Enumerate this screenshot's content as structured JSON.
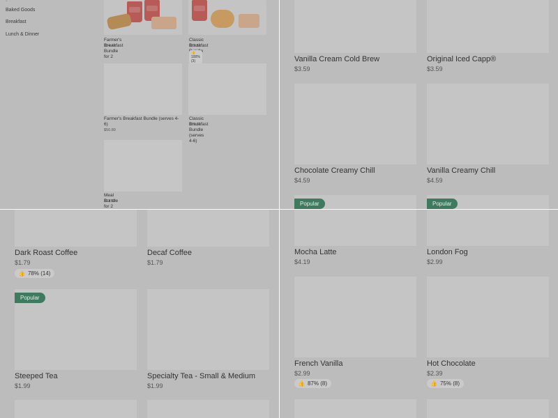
{
  "categories": [
    "Baked Goods",
    "Breakfast",
    "Lunch & Dinner"
  ],
  "q1_products": [
    {
      "name": "Farmer's Breakfast Bundle for 2",
      "price": "$24.49"
    },
    {
      "name": "Classic Breakfast Bundle for 2",
      "price": "$22.59",
      "rating": "100% (3)"
    },
    {
      "name": "Farmer's Breakfast Bundle (serves 4-6)",
      "price": "$50.89"
    },
    {
      "name": "Classic Breakfast Bundle (serves 4-6)",
      "price": "$39.99"
    },
    {
      "name": "Meal Bundle for 2",
      "price": "$21.59"
    }
  ],
  "q2_products": [
    {
      "name": "Vanilla Cream Cold Brew",
      "price": "$3.59"
    },
    {
      "name": "Original Iced Capp®",
      "price": "$3.59"
    },
    {
      "name": "Chocolate Creamy Chill",
      "price": "$4.59"
    },
    {
      "name": "Vanilla Creamy Chill",
      "price": "$4.59"
    }
  ],
  "q3_products": [
    {
      "name": "Dark Roast Coffee",
      "price": "$1.79",
      "rating": "78% (14)"
    },
    {
      "name": "Decaf Coffee",
      "price": "$1.79"
    },
    {
      "name": "Steeped Tea",
      "price": "$1.99"
    },
    {
      "name": "Specialty Tea - Small & Medium",
      "price": "$1.99"
    }
  ],
  "q4_products": [
    {
      "name": "Mocha Latte",
      "price": "$4.19"
    },
    {
      "name": "London Fog",
      "price": "$2.99"
    },
    {
      "name": "French Vanilla",
      "price": "$2.99",
      "rating": "87% (8)"
    },
    {
      "name": "Hot Chocolate",
      "price": "$2.39",
      "rating": "75% (8)"
    }
  ],
  "badges": {
    "popular": "Popular"
  },
  "icons": {
    "rating": "thumbs-up-icon"
  },
  "colors": {
    "badge": "#3d7a5e",
    "overlay": "#bdbdbd"
  }
}
